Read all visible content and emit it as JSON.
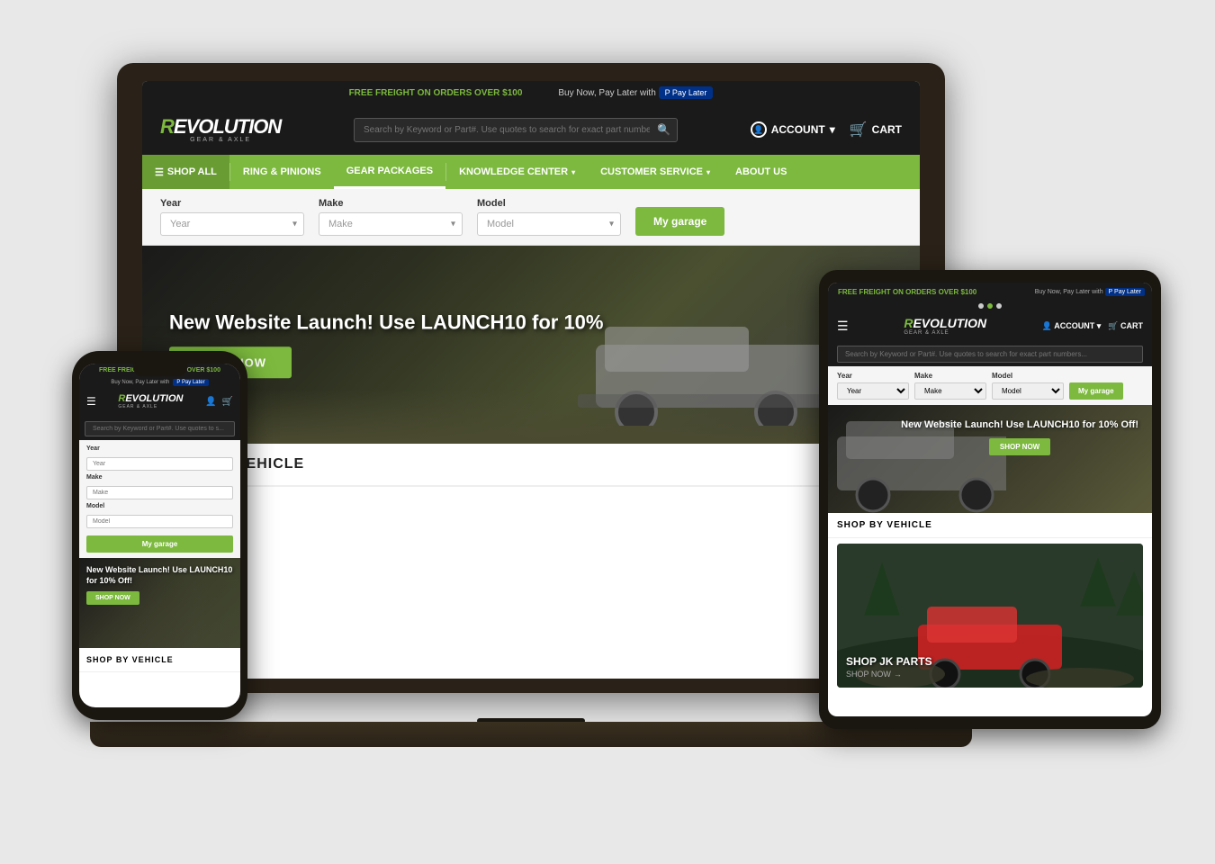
{
  "banner": {
    "promo_text": "FREE FREIGHT ON ORDERS OVER $100",
    "pay_later_text": "Buy Now, Pay Later with",
    "pay_later_btn": "P Pay Later"
  },
  "header": {
    "logo": "REVOLUTION",
    "logo_sub": "GEAR & AXLE",
    "search_placeholder": "Search by Keyword or Part#. Use quotes to search for exact part numbers. Ex...",
    "account_label": "ACCOUNT",
    "cart_label": "CART"
  },
  "nav": {
    "items": [
      {
        "label": "SHOP ALL",
        "id": "shop-all"
      },
      {
        "label": "RING & PINIONS",
        "id": "ring-pinions"
      },
      {
        "label": "GEAR PACKAGES",
        "id": "gear-packages"
      },
      {
        "label": "KNOWLEDGE CENTER",
        "id": "knowledge-center",
        "has_dropdown": true
      },
      {
        "label": "CUSTOMER SERVICE",
        "id": "customer-service",
        "has_dropdown": true
      },
      {
        "label": "ABOUT US",
        "id": "about-us"
      }
    ]
  },
  "garage": {
    "year_label": "Year",
    "year_placeholder": "Year",
    "make_label": "Make",
    "make_placeholder": "Make",
    "model_label": "Model",
    "model_placeholder": "Model",
    "btn_label": "My garage"
  },
  "hero": {
    "title": "New Website Launch! Use LAUNCH10 for 10%",
    "title_full": "New Website Launch! Use LAUNCH10 for 10% Off!",
    "shop_now": "SHOP NOW"
  },
  "shop_by_vehicle": {
    "heading": "SHOP BY VEHICLE"
  },
  "phone": {
    "banner_text": "FREE FREIGHT ON ORDERS OVER $100",
    "pay_later": "Buy Now, Pay Later with",
    "hero_title": "New Website Launch! Use LAUNCH10 for 10% Off!",
    "shop_now": "SHOP NOW",
    "shop_vehicle": "SHOP BY VEHICLE"
  },
  "tablet": {
    "banner_text": "FREE FREIGHT ON ORDERS OVER $100",
    "pay_later": "Buy Now, Pay Later with",
    "hero_title": "New Website Launch! Use LAUNCH10 for 10% Off!",
    "shop_now": "SHOP NOW",
    "shop_vehicle": "SHOP BY VEHICLE",
    "jk_title": "SHOP JK PARTS",
    "jk_link": "SHOP NOW"
  },
  "colors": {
    "green": "#7cb93e",
    "dark": "#1a1a1a",
    "white": "#ffffff"
  }
}
